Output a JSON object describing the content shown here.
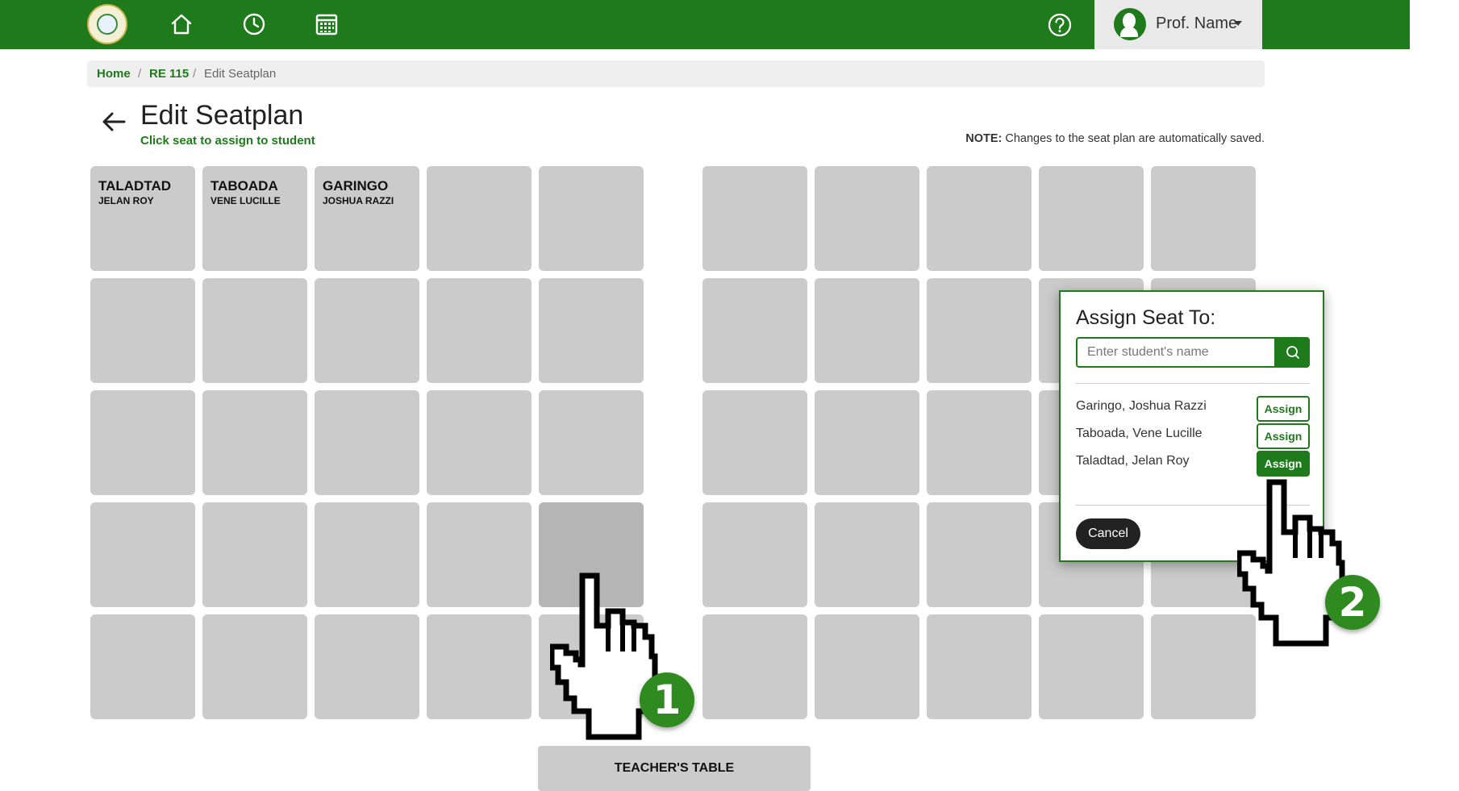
{
  "header": {
    "profile_name": "Prof. Name",
    "nav_icons": [
      "home-icon",
      "history-icon",
      "calendar-icon"
    ],
    "help_icon": "help-icon",
    "brand_color": "#1e7a1a"
  },
  "breadcrumb": {
    "home": "Home",
    "course": "RE 115",
    "current": "Edit Seatplan",
    "separator": "/"
  },
  "page": {
    "title": "Edit Seatplan",
    "subtitle": "Click seat to assign to student",
    "note_label": "NOTE:",
    "note_text": " Changes to the seat plan are automatically saved."
  },
  "seats": {
    "left_block": [
      [
        {
          "last": "TALADTAD",
          "first": "JELAN ROY"
        },
        {
          "last": "TABOADA",
          "first": "VENE LUCILLE"
        },
        {
          "last": "GARINGO",
          "first": "JOSHUA RAZZI"
        },
        {
          "last": "",
          "first": ""
        },
        {
          "last": "",
          "first": ""
        }
      ],
      [
        {
          "last": "",
          "first": ""
        },
        {
          "last": "",
          "first": ""
        },
        {
          "last": "",
          "first": ""
        },
        {
          "last": "",
          "first": ""
        },
        {
          "last": "",
          "first": ""
        }
      ],
      [
        {
          "last": "",
          "first": ""
        },
        {
          "last": "",
          "first": ""
        },
        {
          "last": "",
          "first": ""
        },
        {
          "last": "",
          "first": ""
        },
        {
          "last": "",
          "first": ""
        }
      ],
      [
        {
          "last": "",
          "first": ""
        },
        {
          "last": "",
          "first": ""
        },
        {
          "last": "",
          "first": ""
        },
        {
          "last": "",
          "first": ""
        },
        {
          "last": "",
          "first": ""
        }
      ],
      [
        {
          "last": "",
          "first": ""
        },
        {
          "last": "",
          "first": ""
        },
        {
          "last": "",
          "first": ""
        },
        {
          "last": "",
          "first": ""
        },
        {
          "last": "",
          "first": ""
        }
      ]
    ],
    "right_block_rows": 5,
    "right_block_cols": 5
  },
  "teacher_table": "TEACHER'S TABLE",
  "popup": {
    "title": "Assign Seat To:",
    "search_placeholder": "Enter student's name",
    "students": [
      {
        "name": "Garingo, Joshua Razzi",
        "action": "Assign"
      },
      {
        "name": "Taboada, Vene Lucille",
        "action": "Assign"
      },
      {
        "name": "Taladtad, Jelan Roy",
        "action": "Assign"
      }
    ],
    "cancel_label": "Cancel"
  },
  "steps": [
    "1",
    "2"
  ]
}
